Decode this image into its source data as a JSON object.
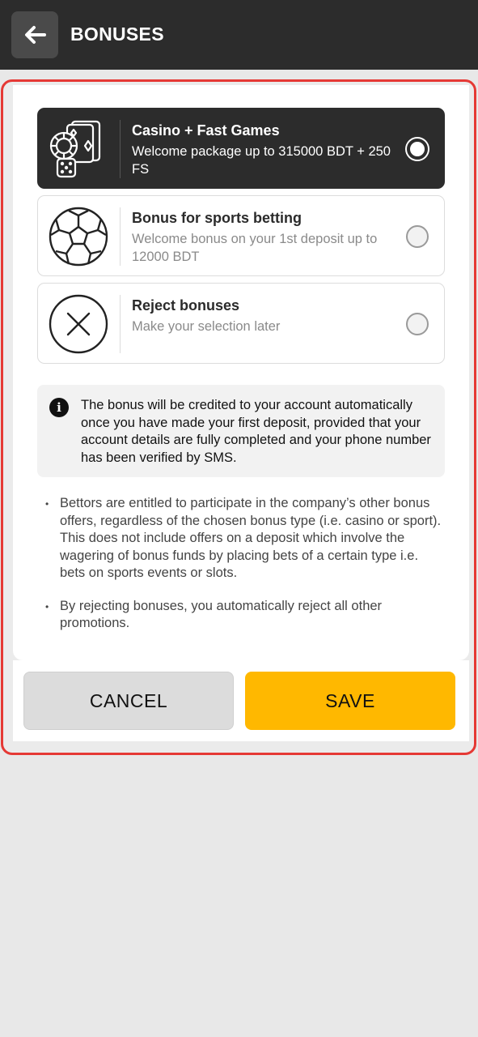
{
  "header": {
    "title": "BONUSES",
    "back_icon": "arrow-left-icon"
  },
  "options": [
    {
      "title": "Casino + Fast Games",
      "subtitle": "Welcome package up to 315000 BDT + 250 FS",
      "icon": "casino-chips-cards-dice-icon",
      "selected": true
    },
    {
      "title": "Bonus for sports betting",
      "subtitle": "Welcome bonus on your 1st deposit up to 12000 BDT",
      "icon": "soccer-ball-icon",
      "selected": false
    },
    {
      "title": "Reject bonuses",
      "subtitle": "Make your selection later",
      "icon": "close-circle-icon",
      "selected": false
    }
  ],
  "info": {
    "icon": "info-icon",
    "text": "The bonus will be credited to your account automatically once you have made your first deposit, provided that your account details are fully completed and your phone number has been verified by SMS."
  },
  "notes": [
    "Bettors are entitled to participate in the company’s other bonus offers, regardless of the chosen bonus type (i.e. casino or sport). This does not include offers on a deposit which involve the wagering of bonus funds by placing bets of a certain type i.e. bets on sports events or slots.",
    "By rejecting bonuses, you automatically reject all other promotions."
  ],
  "actions": {
    "cancel_label": "CANCEL",
    "save_label": "SAVE"
  },
  "colors": {
    "header_bg": "#2c2c2c",
    "selected_bg": "#2c2c2c",
    "save_bg": "#ffb800",
    "cancel_bg": "#dcdcdc",
    "highlight_border": "#e53935"
  }
}
